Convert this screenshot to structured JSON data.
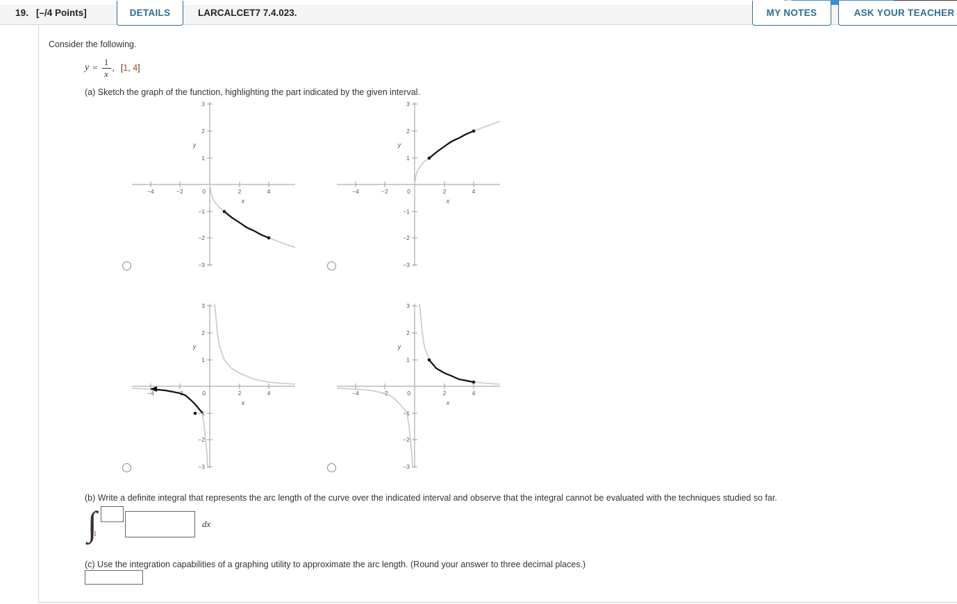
{
  "header": {
    "question_number": "19.",
    "points": "[–/4 Points]",
    "details_label": "DETAILS",
    "textbook_code": "LARCALCET7 7.4.023.",
    "my_notes_label": "MY NOTES",
    "ask_teacher_label": "ASK YOUR TEACHER",
    "accent_color": "#2d6e93",
    "bar_color": "#f4f4f4"
  },
  "problem": {
    "intro": "Consider the following.",
    "equation": {
      "lhs": "y",
      "equals": "=",
      "numerator": "1",
      "denominator": "x",
      "comma": ",",
      "interval_open": "[",
      "interval_a": "1",
      "interval_sep": ", ",
      "interval_b": "4",
      "interval_close": "]",
      "interval_color": "#c0392b"
    },
    "part_a": {
      "text": "(a) Sketch the graph of the function, highlighting the part indicated by the given interval."
    },
    "part_b": {
      "text": "(b) Write a definite integral that represents the arc length of the curve over the indicated interval and observe that the integral cannot be evaluated with the techniques studied so far.",
      "lower_limit": "1",
      "upper_limit_value": "",
      "upper_limit_placeholder": "",
      "integrand_value": "",
      "integrand_placeholder": "",
      "dx": "dx"
    },
    "part_c": {
      "text": "(c) Use the integration capabilities of a graphing utility to approximate the arc length. (Round your answer to three decimal places.)",
      "answer_value": "",
      "answer_placeholder": ""
    }
  },
  "chart_data": [
    {
      "id": "choice-1",
      "type": "line",
      "title": "",
      "xlabel": "x",
      "ylabel": "y",
      "xlim": [
        -5.3,
        5.3
      ],
      "ylim": [
        -3,
        3
      ],
      "xticks": [
        -4,
        -2,
        0,
        2,
        4
      ],
      "yticks": [
        -3,
        -2,
        -1,
        0,
        1,
        2,
        3
      ],
      "xticklabels": [
        "−4",
        "−2",
        "0",
        "2",
        "4"
      ],
      "yticklabels": [
        "−3",
        "−2",
        "−1",
        "",
        "1",
        "2",
        "3"
      ],
      "grid": false,
      "legend": "none",
      "description": "y = -sqrt(x), light gray full curve with black highlighted segment from x=1 to x=4",
      "series": [
        {
          "name": "full-curve",
          "color": "#c8c8c8",
          "x": [
            0.0,
            0.1,
            0.3,
            0.6,
            1.0,
            1.5,
            2.0,
            2.5,
            3.0,
            3.5,
            4.0,
            4.5,
            5.0
          ],
          "y": [
            0.0,
            -0.32,
            -0.55,
            -0.77,
            -1.0,
            -1.22,
            -1.41,
            -1.58,
            -1.73,
            -1.87,
            -2.0,
            -2.12,
            -2.24
          ]
        },
        {
          "name": "highlighted-segment",
          "color": "#111111",
          "x": [
            1.0,
            1.5,
            2.0,
            2.5,
            3.0,
            3.5,
            4.0
          ],
          "y": [
            -1.0,
            -1.22,
            -1.41,
            -1.58,
            -1.73,
            -1.87,
            -2.0
          ]
        }
      ],
      "endpoints": [
        {
          "x": 1,
          "y": -1
        },
        {
          "x": 4,
          "y": -2
        }
      ]
    },
    {
      "id": "choice-2",
      "type": "line",
      "title": "",
      "xlabel": "x",
      "ylabel": "y",
      "xlim": [
        -5.3,
        5.3
      ],
      "ylim": [
        -3,
        3
      ],
      "xticks": [
        -4,
        -2,
        0,
        2,
        4
      ],
      "yticks": [
        -3,
        -2,
        -1,
        0,
        1,
        2,
        3
      ],
      "xticklabels": [
        "−4",
        "−2",
        "0",
        "2",
        "4"
      ],
      "yticklabels": [
        "−3",
        "−2",
        "−1",
        "",
        "1",
        "2",
        "3"
      ],
      "grid": false,
      "legend": "none",
      "description": "y = sqrt(x), light gray full curve with black highlighted segment from x=1 to x=4",
      "series": [
        {
          "name": "full-curve",
          "color": "#c8c8c8",
          "x": [
            0.0,
            0.1,
            0.3,
            0.6,
            1.0,
            1.5,
            2.0,
            2.5,
            3.0,
            3.5,
            4.0,
            4.5,
            5.0
          ],
          "y": [
            0.0,
            0.32,
            0.55,
            0.77,
            1.0,
            1.22,
            1.41,
            1.58,
            1.73,
            1.87,
            2.0,
            2.12,
            2.24
          ]
        },
        {
          "name": "highlighted-segment",
          "color": "#111111",
          "x": [
            1.0,
            1.5,
            2.0,
            2.5,
            3.0,
            3.5,
            4.0
          ],
          "y": [
            1.0,
            1.22,
            1.41,
            1.58,
            1.73,
            1.87,
            2.0
          ]
        }
      ],
      "endpoints": [
        {
          "x": 1,
          "y": 1
        },
        {
          "x": 4,
          "y": 2
        }
      ]
    },
    {
      "id": "choice-3",
      "type": "line",
      "title": "",
      "xlabel": "x",
      "ylabel": "y",
      "xlim": [
        -5.3,
        5.3
      ],
      "ylim": [
        -3,
        3
      ],
      "xticks": [
        -4,
        -2,
        0,
        2,
        4
      ],
      "yticks": [
        -3,
        -2,
        -1,
        0,
        1,
        2,
        3
      ],
      "xticklabels": [
        "−4",
        "−2",
        "0",
        "2",
        "4"
      ],
      "yticklabels": [
        "−3",
        "−2",
        "−1",
        "",
        "1",
        "2",
        "3"
      ],
      "grid": false,
      "legend": "none",
      "description": "y = 1/x both branches in light gray; black highlighted segment on the negative branch from x=-1 leftwards with an arrowhead near x=-4",
      "series": [
        {
          "name": "full-curve-positive-branch",
          "color": "#c8c8c8",
          "x": [
            0.333,
            0.4,
            0.5,
            0.7,
            1.0,
            1.5,
            2.0,
            2.5,
            3.0,
            4.0,
            5.0
          ],
          "y": [
            3.0,
            2.5,
            2.0,
            1.43,
            1.0,
            0.67,
            0.5,
            0.4,
            0.33,
            0.25,
            0.2
          ]
        },
        {
          "name": "full-curve-negative-branch",
          "color": "#c8c8c8",
          "x": [
            -5.0,
            -4.0,
            -3.0,
            -2.5,
            -2.0,
            -1.5,
            -1.0,
            -0.7,
            -0.5,
            -0.4,
            -0.333
          ],
          "y": [
            -0.2,
            -0.25,
            -0.33,
            -0.4,
            -0.5,
            -0.67,
            -1.0,
            -1.43,
            -2.0,
            -2.5,
            -3.0
          ]
        },
        {
          "name": "highlighted-segment",
          "color": "#111111",
          "x": [
            -4.0,
            -3.0,
            -2.5,
            -2.0,
            -1.5,
            -1.0
          ],
          "y": [
            -0.25,
            -0.33,
            -0.4,
            -0.5,
            -0.67,
            -1.0
          ]
        }
      ],
      "endpoints": [
        {
          "x": -1,
          "y": -1
        }
      ],
      "arrowheads": [
        {
          "x": -4,
          "y": -0.25,
          "direction": "left"
        }
      ]
    },
    {
      "id": "choice-4",
      "type": "line",
      "title": "",
      "xlabel": "x",
      "ylabel": "y",
      "xlim": [
        -5.3,
        5.3
      ],
      "ylim": [
        -3,
        3
      ],
      "xticks": [
        -4,
        -2,
        0,
        2,
        4
      ],
      "yticks": [
        -3,
        -2,
        -1,
        0,
        1,
        2,
        3
      ],
      "xticklabels": [
        "−4",
        "−2",
        "0",
        "2",
        "4"
      ],
      "yticklabels": [
        "−3",
        "−2",
        "−1",
        "",
        "1",
        "2",
        "3"
      ],
      "grid": false,
      "legend": "none",
      "description": "y = 1/x both branches in light gray; black highlighted segment on the positive branch from (1,1) to (4,0.25)",
      "series": [
        {
          "name": "full-curve-positive-branch",
          "color": "#c8c8c8",
          "x": [
            0.333,
            0.4,
            0.5,
            0.7,
            1.0,
            1.5,
            2.0,
            2.5,
            3.0,
            4.0,
            5.0
          ],
          "y": [
            3.0,
            2.5,
            2.0,
            1.43,
            1.0,
            0.67,
            0.5,
            0.4,
            0.33,
            0.25,
            0.2
          ]
        },
        {
          "name": "full-curve-negative-branch",
          "color": "#c8c8c8",
          "x": [
            -5.0,
            -4.0,
            -3.0,
            -2.5,
            -2.0,
            -1.5,
            -1.0,
            -0.7,
            -0.5,
            -0.4,
            -0.333
          ],
          "y": [
            -0.2,
            -0.25,
            -0.33,
            -0.4,
            -0.5,
            -0.67,
            -1.0,
            -1.43,
            -2.0,
            -2.5,
            -3.0
          ]
        },
        {
          "name": "highlighted-segment",
          "color": "#111111",
          "x": [
            1.0,
            1.5,
            2.0,
            2.5,
            3.0,
            3.5,
            4.0
          ],
          "y": [
            1.0,
            0.67,
            0.5,
            0.4,
            0.333,
            0.286,
            0.25
          ]
        }
      ],
      "endpoints": [
        {
          "x": 1,
          "y": 1
        },
        {
          "x": 4,
          "y": 0.25
        }
      ]
    }
  ],
  "choices": [
    {
      "id": "choice-1",
      "selected": false
    },
    {
      "id": "choice-2",
      "selected": false
    },
    {
      "id": "choice-3",
      "selected": false
    },
    {
      "id": "choice-4",
      "selected": false
    }
  ]
}
